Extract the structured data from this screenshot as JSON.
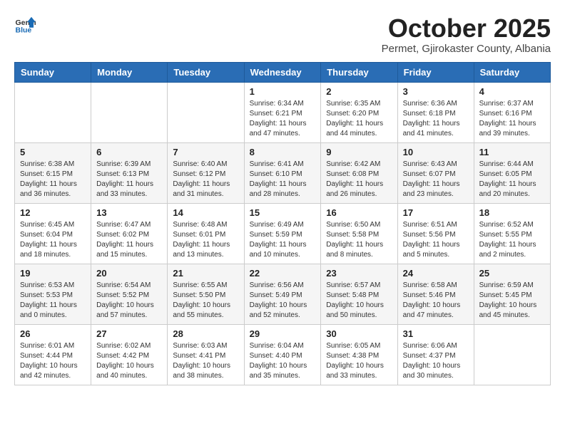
{
  "header": {
    "logo_general": "General",
    "logo_blue": "Blue",
    "month_title": "October 2025",
    "location": "Permet, Gjirokaster County, Albania"
  },
  "weekdays": [
    "Sunday",
    "Monday",
    "Tuesday",
    "Wednesday",
    "Thursday",
    "Friday",
    "Saturday"
  ],
  "weeks": [
    [
      {
        "day": "",
        "info": ""
      },
      {
        "day": "",
        "info": ""
      },
      {
        "day": "",
        "info": ""
      },
      {
        "day": "1",
        "info": "Sunrise: 6:34 AM\nSunset: 6:21 PM\nDaylight: 11 hours\nand 47 minutes."
      },
      {
        "day": "2",
        "info": "Sunrise: 6:35 AM\nSunset: 6:20 PM\nDaylight: 11 hours\nand 44 minutes."
      },
      {
        "day": "3",
        "info": "Sunrise: 6:36 AM\nSunset: 6:18 PM\nDaylight: 11 hours\nand 41 minutes."
      },
      {
        "day": "4",
        "info": "Sunrise: 6:37 AM\nSunset: 6:16 PM\nDaylight: 11 hours\nand 39 minutes."
      }
    ],
    [
      {
        "day": "5",
        "info": "Sunrise: 6:38 AM\nSunset: 6:15 PM\nDaylight: 11 hours\nand 36 minutes."
      },
      {
        "day": "6",
        "info": "Sunrise: 6:39 AM\nSunset: 6:13 PM\nDaylight: 11 hours\nand 33 minutes."
      },
      {
        "day": "7",
        "info": "Sunrise: 6:40 AM\nSunset: 6:12 PM\nDaylight: 11 hours\nand 31 minutes."
      },
      {
        "day": "8",
        "info": "Sunrise: 6:41 AM\nSunset: 6:10 PM\nDaylight: 11 hours\nand 28 minutes."
      },
      {
        "day": "9",
        "info": "Sunrise: 6:42 AM\nSunset: 6:08 PM\nDaylight: 11 hours\nand 26 minutes."
      },
      {
        "day": "10",
        "info": "Sunrise: 6:43 AM\nSunset: 6:07 PM\nDaylight: 11 hours\nand 23 minutes."
      },
      {
        "day": "11",
        "info": "Sunrise: 6:44 AM\nSunset: 6:05 PM\nDaylight: 11 hours\nand 20 minutes."
      }
    ],
    [
      {
        "day": "12",
        "info": "Sunrise: 6:45 AM\nSunset: 6:04 PM\nDaylight: 11 hours\nand 18 minutes."
      },
      {
        "day": "13",
        "info": "Sunrise: 6:47 AM\nSunset: 6:02 PM\nDaylight: 11 hours\nand 15 minutes."
      },
      {
        "day": "14",
        "info": "Sunrise: 6:48 AM\nSunset: 6:01 PM\nDaylight: 11 hours\nand 13 minutes."
      },
      {
        "day": "15",
        "info": "Sunrise: 6:49 AM\nSunset: 5:59 PM\nDaylight: 11 hours\nand 10 minutes."
      },
      {
        "day": "16",
        "info": "Sunrise: 6:50 AM\nSunset: 5:58 PM\nDaylight: 11 hours\nand 8 minutes."
      },
      {
        "day": "17",
        "info": "Sunrise: 6:51 AM\nSunset: 5:56 PM\nDaylight: 11 hours\nand 5 minutes."
      },
      {
        "day": "18",
        "info": "Sunrise: 6:52 AM\nSunset: 5:55 PM\nDaylight: 11 hours\nand 2 minutes."
      }
    ],
    [
      {
        "day": "19",
        "info": "Sunrise: 6:53 AM\nSunset: 5:53 PM\nDaylight: 11 hours\nand 0 minutes."
      },
      {
        "day": "20",
        "info": "Sunrise: 6:54 AM\nSunset: 5:52 PM\nDaylight: 10 hours\nand 57 minutes."
      },
      {
        "day": "21",
        "info": "Sunrise: 6:55 AM\nSunset: 5:50 PM\nDaylight: 10 hours\nand 55 minutes."
      },
      {
        "day": "22",
        "info": "Sunrise: 6:56 AM\nSunset: 5:49 PM\nDaylight: 10 hours\nand 52 minutes."
      },
      {
        "day": "23",
        "info": "Sunrise: 6:57 AM\nSunset: 5:48 PM\nDaylight: 10 hours\nand 50 minutes."
      },
      {
        "day": "24",
        "info": "Sunrise: 6:58 AM\nSunset: 5:46 PM\nDaylight: 10 hours\nand 47 minutes."
      },
      {
        "day": "25",
        "info": "Sunrise: 6:59 AM\nSunset: 5:45 PM\nDaylight: 10 hours\nand 45 minutes."
      }
    ],
    [
      {
        "day": "26",
        "info": "Sunrise: 6:01 AM\nSunset: 4:44 PM\nDaylight: 10 hours\nand 42 minutes."
      },
      {
        "day": "27",
        "info": "Sunrise: 6:02 AM\nSunset: 4:42 PM\nDaylight: 10 hours\nand 40 minutes."
      },
      {
        "day": "28",
        "info": "Sunrise: 6:03 AM\nSunset: 4:41 PM\nDaylight: 10 hours\nand 38 minutes."
      },
      {
        "day": "29",
        "info": "Sunrise: 6:04 AM\nSunset: 4:40 PM\nDaylight: 10 hours\nand 35 minutes."
      },
      {
        "day": "30",
        "info": "Sunrise: 6:05 AM\nSunset: 4:38 PM\nDaylight: 10 hours\nand 33 minutes."
      },
      {
        "day": "31",
        "info": "Sunrise: 6:06 AM\nSunset: 4:37 PM\nDaylight: 10 hours\nand 30 minutes."
      },
      {
        "day": "",
        "info": ""
      }
    ]
  ]
}
